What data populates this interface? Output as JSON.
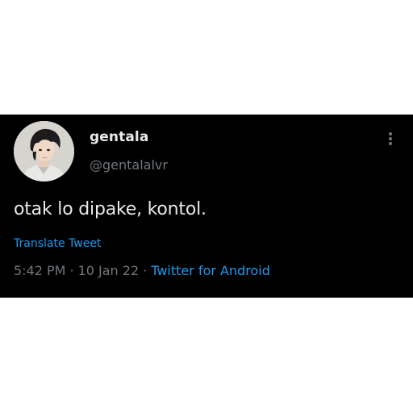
{
  "tweet": {
    "author": {
      "display_name": "gentala",
      "handle": "@gentalalvr",
      "avatar_icon": "profile-photo"
    },
    "text": "otak lo dipake, kontol.",
    "translate_label": "Translate Tweet",
    "time": "5:42 PM",
    "date": "10 Jan 22",
    "separator": "·",
    "source": "Twitter for Android",
    "menu_icon": "more-vertical-icon"
  },
  "colors": {
    "background": "#000000",
    "text_primary": "#e7e9ea",
    "text_secondary": "#71767b",
    "link": "#1d9bf0",
    "page": "#ffffff"
  }
}
